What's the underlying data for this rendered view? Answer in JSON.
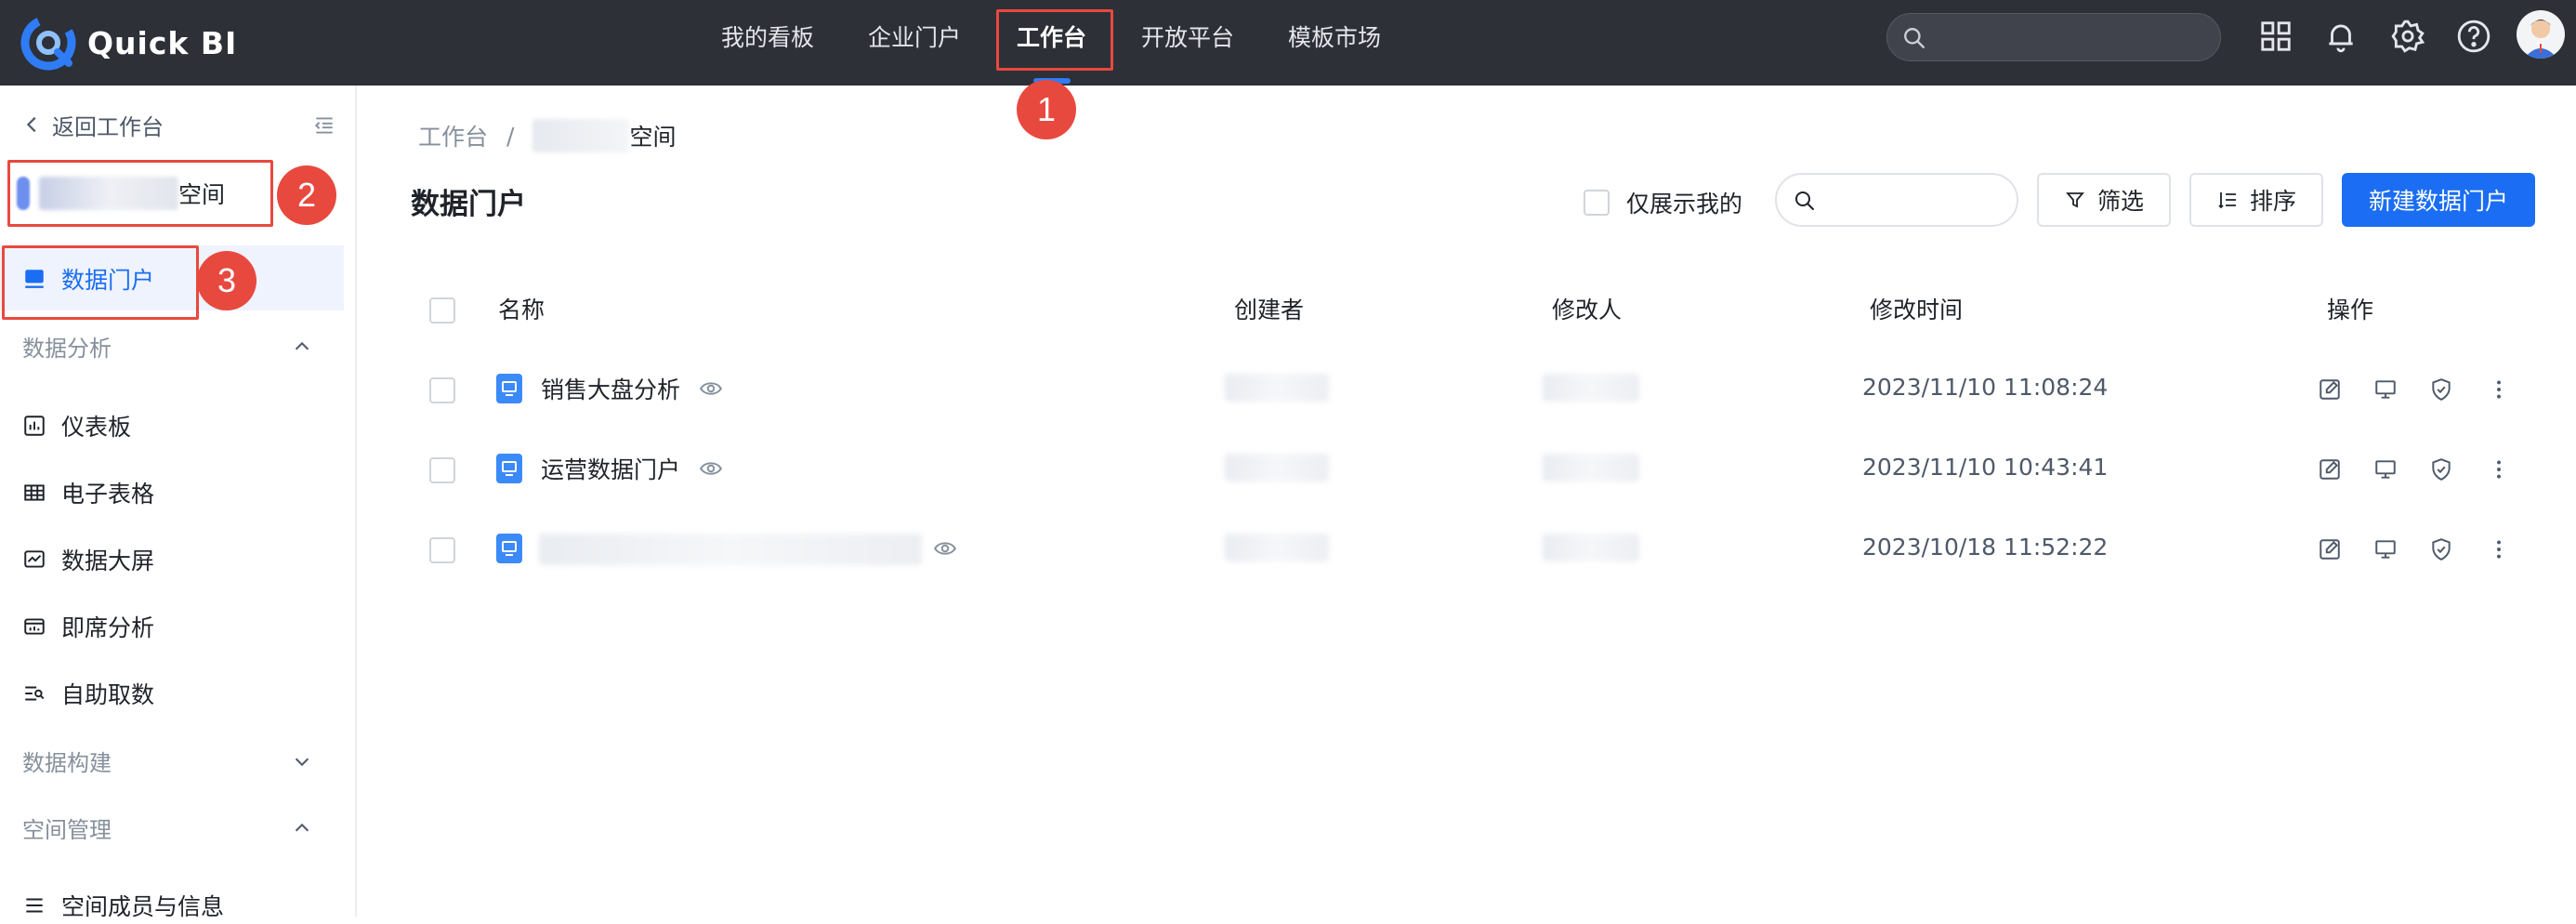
{
  "app": {
    "name": "Quick BI"
  },
  "topnav": {
    "items": [
      {
        "label": "我的看板"
      },
      {
        "label": "企业门户"
      },
      {
        "label": "工作台",
        "active": true
      },
      {
        "label": "开放平台"
      },
      {
        "label": "模板市场"
      }
    ],
    "search_placeholder": "",
    "icons": [
      "apps-grid-icon",
      "bell-icon",
      "gear-icon",
      "help-icon"
    ]
  },
  "sidebar": {
    "back_label": "返回工作台",
    "space_suffix": "空间",
    "menu_portal": "数据门户",
    "group_analysis": "数据分析",
    "analysis_items": [
      {
        "label": "仪表板",
        "icon": "dashboard-icon"
      },
      {
        "label": "电子表格",
        "icon": "table-icon"
      },
      {
        "label": "数据大屏",
        "icon": "screen-icon"
      },
      {
        "label": "即席分析",
        "icon": "adhoc-icon"
      },
      {
        "label": "自助取数",
        "icon": "fetch-icon"
      }
    ],
    "group_build": "数据构建",
    "group_space": "空间管理",
    "space_items": [
      {
        "label": "空间成员与信息"
      }
    ]
  },
  "breadcrumb": {
    "root": "工作台",
    "separator": "/",
    "current_suffix": "空间"
  },
  "page": {
    "title": "数据门户",
    "only_mine_label": "仅展示我的",
    "search_placeholder": "",
    "filter_label": "筛选",
    "sort_label": "排序",
    "create_label": "新建数据门户"
  },
  "table": {
    "columns": [
      "名称",
      "创建者",
      "修改人",
      "修改时间",
      "操作"
    ],
    "rows": [
      {
        "name": "销售大盘分析",
        "modified": "2023/11/10 11:08:24"
      },
      {
        "name": "运营数据门户",
        "modified": "2023/11/10 10:43:41"
      },
      {
        "name": "",
        "modified": "2023/10/18 11:52:22"
      }
    ],
    "row_actions": [
      "edit-icon",
      "preview-icon",
      "permission-icon",
      "more-icon"
    ]
  },
  "annotations": [
    "1",
    "2",
    "3"
  ],
  "colors": {
    "topbar": "#2d3037",
    "accent": "#1b6ef3",
    "annotation": "#e8493f",
    "active_bg": "#eef3fe"
  }
}
